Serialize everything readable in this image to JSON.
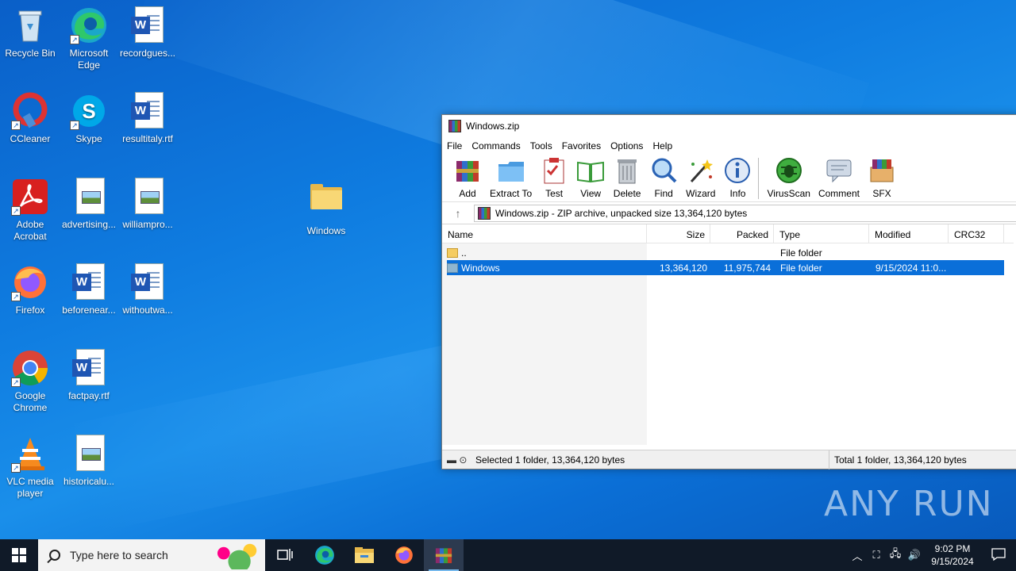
{
  "desktop": {
    "icons": [
      {
        "label": "Recycle Bin"
      },
      {
        "label": "Microsoft Edge"
      },
      {
        "label": "recordgues..."
      },
      {
        "label": "CCleaner"
      },
      {
        "label": "Skype"
      },
      {
        "label": "resultitaly.rtf"
      },
      {
        "label": "Adobe Acrobat"
      },
      {
        "label": "advertising..."
      },
      {
        "label": "williampro..."
      },
      {
        "label": "Windows"
      },
      {
        "label": "Firefox"
      },
      {
        "label": "beforenear..."
      },
      {
        "label": "withoutwa..."
      },
      {
        "label": "Google Chrome"
      },
      {
        "label": "factpay.rtf"
      },
      {
        "label": "VLC media player"
      },
      {
        "label": "historicalu..."
      }
    ]
  },
  "winrar": {
    "title": "Windows.zip",
    "menu": [
      "File",
      "Commands",
      "Tools",
      "Favorites",
      "Options",
      "Help"
    ],
    "toolbar": [
      "Add",
      "Extract To",
      "Test",
      "View",
      "Delete",
      "Find",
      "Wizard",
      "Info",
      "VirusScan",
      "Comment",
      "SFX"
    ],
    "address": "Windows.zip - ZIP archive, unpacked size 13,364,120 bytes",
    "columns": [
      "Name",
      "Size",
      "Packed",
      "Type",
      "Modified",
      "CRC32"
    ],
    "rows": [
      {
        "name": "..",
        "size": "",
        "packed": "",
        "type": "File folder",
        "modified": "",
        "crc": ""
      },
      {
        "name": "Windows",
        "size": "13,364,120",
        "packed": "11,975,744",
        "type": "File folder",
        "modified": "9/15/2024 11:0...",
        "crc": ""
      }
    ],
    "status_left": "Selected 1 folder, 13,364,120 bytes",
    "status_right": "Total 1 folder, 13,364,120 bytes"
  },
  "taskbar": {
    "search_placeholder": "Type here to search",
    "time": "9:02 PM",
    "date": "9/15/2024"
  },
  "watermark": "ANY RUN"
}
